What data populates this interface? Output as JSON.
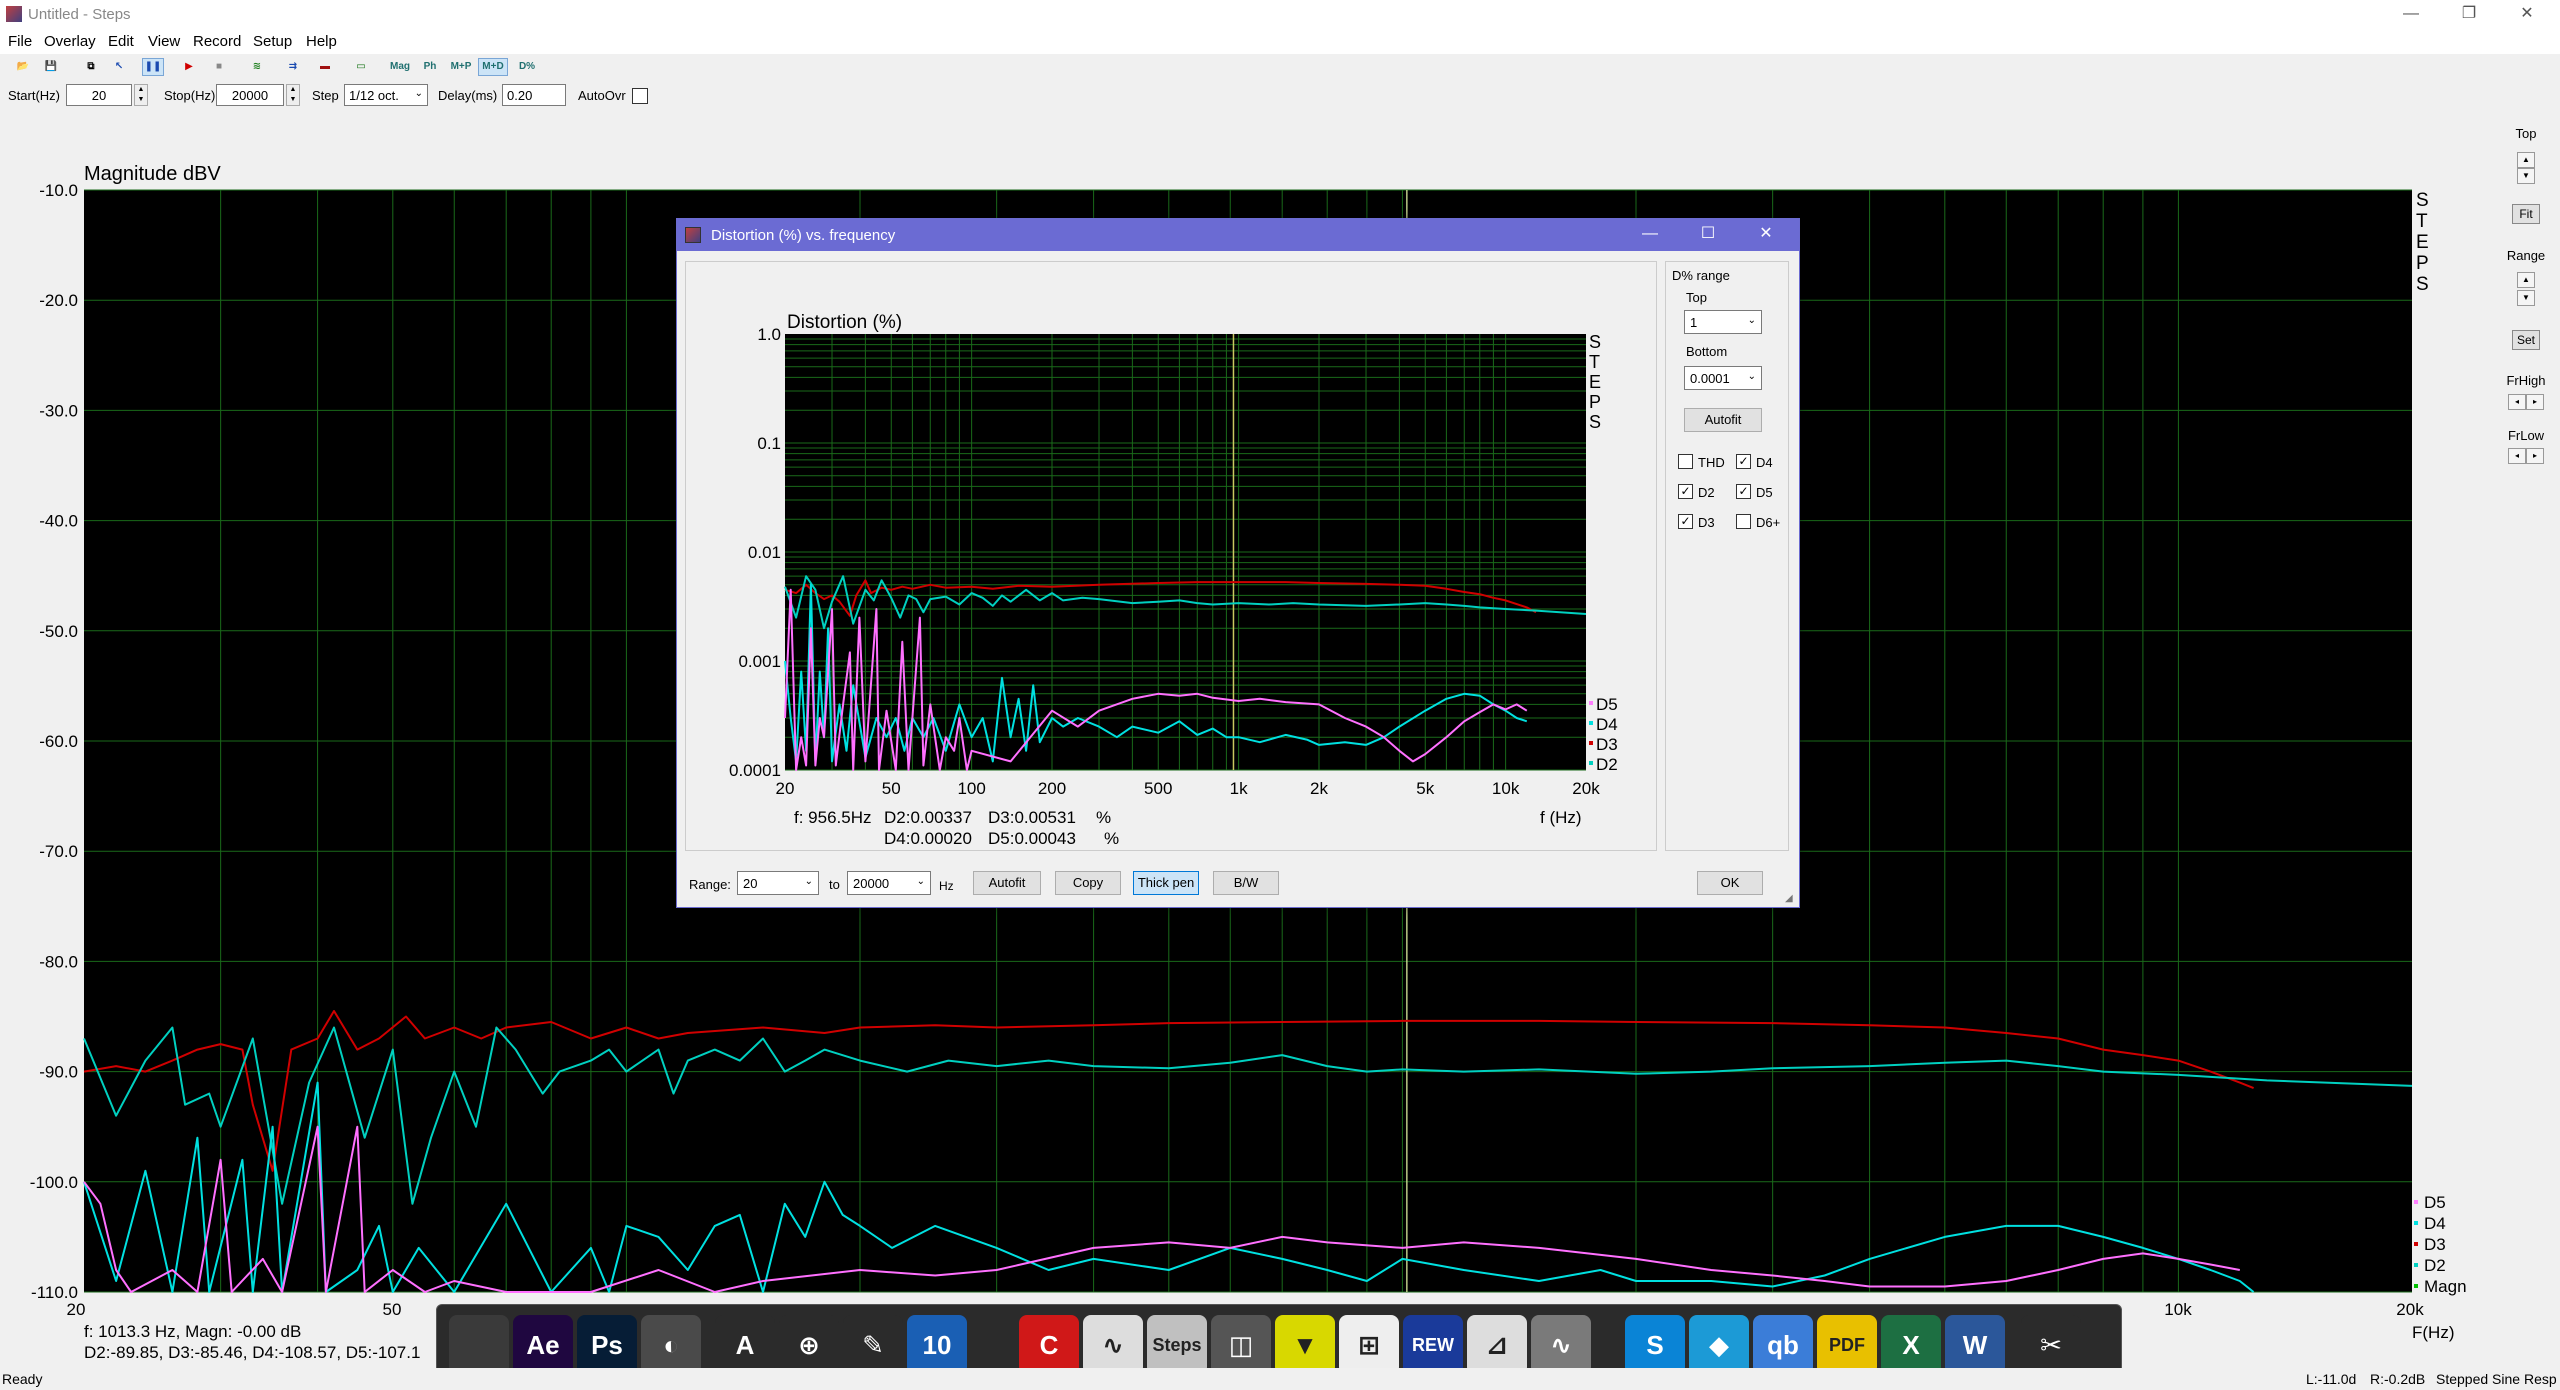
{
  "window": {
    "title": "Untitled - Steps",
    "minimize": "—",
    "restore": "❐",
    "close": "✕"
  },
  "menu": [
    "File",
    "Overlay",
    "Edit",
    "View",
    "Record",
    "Setup",
    "Help"
  ],
  "toolbar": {
    "buttons": [
      {
        "name": "open-icon",
        "label": "📂"
      },
      {
        "name": "save-icon",
        "label": "💾"
      },
      {
        "name": "copy-icon",
        "label": "⧉"
      },
      {
        "name": "cursor-icon",
        "label": "↖"
      },
      {
        "name": "pause-icon",
        "label": "❚❚"
      },
      {
        "name": "record-icon",
        "label": "▶"
      },
      {
        "name": "stop-icon",
        "label": "■"
      },
      {
        "name": "generator-icon",
        "label": "≋"
      },
      {
        "name": "overlay-icon",
        "label": "⇉"
      },
      {
        "name": "flag-icon",
        "label": "▬"
      },
      {
        "name": "display-icon",
        "label": "▭"
      }
    ],
    "text_buttons": [
      "Mag",
      "Ph",
      "M+P",
      "M+D",
      "D%"
    ]
  },
  "params": {
    "start_label": "Start(Hz)",
    "start_value": "20",
    "stop_label": "Stop(Hz)",
    "stop_value": "20000",
    "step_label": "Step",
    "step_value": "1/12 oct.",
    "delay_label": "Delay(ms)",
    "delay_value": "0.20",
    "autoovr_label": "AutoOvr"
  },
  "main_chart": {
    "ylabel": "Magnitude dBV",
    "xlabel": "F(Hz)",
    "yticks": [
      "-10.0",
      "-20.0",
      "-30.0",
      "-40.0",
      "-50.0",
      "-60.0",
      "-70.0",
      "-80.0",
      "-90.0",
      "-100.0",
      "-110.0"
    ],
    "xticks_visible": [
      "20",
      "50",
      "10k",
      "20k"
    ],
    "readout_line1": "f: 1013.3 Hz, Magn: -0.00 dB",
    "readout_line2": "D2:-89.85, D3:-85.46, D4:-108.57, D5:-107.1",
    "steps_vertical": "STEPS",
    "legend": [
      {
        "label": "D5",
        "color": "#ff80ff"
      },
      {
        "label": "D4",
        "color": "#00e0e0"
      },
      {
        "label": "D3",
        "color": "#d00000"
      },
      {
        "label": "D2",
        "color": "#00d0c0"
      },
      {
        "label": "Magn",
        "color": "#00c000"
      }
    ]
  },
  "right_panel": {
    "top_label": "Top",
    "fit_label": "Fit",
    "range_label": "Range",
    "set_label": "Set",
    "frhigh_label": "FrHigh",
    "frlow_label": "FrLow"
  },
  "dialog": {
    "title": "Distortion (%) vs. frequency",
    "minimize": "—",
    "maximize": "☐",
    "close": "✕",
    "chart_title": "Distortion (%)",
    "yticks": [
      "1.0",
      "0.1",
      "0.01",
      "0.001",
      "0.0001"
    ],
    "xticks": [
      "20",
      "50",
      "100",
      "200",
      "500",
      "1k",
      "2k",
      "5k",
      "10k",
      "20k"
    ],
    "xlabel": "f (Hz)",
    "steps_vertical": "STEPS",
    "readout": {
      "f": "f: 956.5Hz",
      "d2": "D2:0.00337",
      "d3": "D3:0.00531",
      "pct1": "%",
      "d4": "D4:0.00020",
      "d5": "D5:0.00043",
      "pct2": "%"
    },
    "legend": [
      {
        "label": "D5",
        "color": "#ff80ff"
      },
      {
        "label": "D4",
        "color": "#00e0e0"
      },
      {
        "label": "D3",
        "color": "#d00000"
      },
      {
        "label": "D2",
        "color": "#00d0c0"
      }
    ],
    "side": {
      "group_label": "D% range",
      "top_label": "Top",
      "top_value": "1",
      "bottom_label": "Bottom",
      "bottom_value": "0.0001",
      "autofit_label": "Autofit",
      "checks": [
        {
          "label": "THD",
          "checked": false
        },
        {
          "label": "D4",
          "checked": true
        },
        {
          "label": "D2",
          "checked": true
        },
        {
          "label": "D5",
          "checked": true
        },
        {
          "label": "D3",
          "checked": true
        },
        {
          "label": "D6+",
          "checked": false
        }
      ]
    },
    "bottom": {
      "range_label": "Range:",
      "range_from": "20",
      "to_label": "to",
      "range_to": "20000",
      "hz_label": "Hz",
      "autofit": "Autofit",
      "copy": "Copy",
      "thick_pen": "Thick pen",
      "bw": "B/W",
      "ok": "OK"
    }
  },
  "status": {
    "left": "Ready",
    "levels": "L:-11.0d",
    "right_level": "R:-0.2dB",
    "mode": "Stepped Sine Resp"
  },
  "dock": {
    "icons": [
      {
        "name": "edius-icon",
        "label": "",
        "color": "#3a3a3a"
      },
      {
        "name": "after-effects-icon",
        "label": "Ae",
        "color": "#1f0740"
      },
      {
        "name": "photoshop-icon",
        "label": "Ps",
        "color": "#061d36"
      },
      {
        "name": "davinci-icon",
        "label": "◐",
        "color": "#4a4a4a"
      },
      {
        "name": "wavelab-icon",
        "label": "A",
        "color": "#2b2b2b"
      },
      {
        "name": "green-tool-icon",
        "label": "⊕",
        "color": "#2b2b2b"
      },
      {
        "name": "pencil-icon",
        "label": "✎",
        "color": "#2b2b2b"
      },
      {
        "name": "ten-icon",
        "label": "10",
        "color": "#1a5fb4"
      },
      {
        "name": "red-c-icon",
        "label": "C",
        "color": "#d01818"
      },
      {
        "name": "analyzer-icon",
        "label": "∿",
        "color": "#ddd"
      },
      {
        "name": "steps-icon",
        "label": "Steps",
        "color": "#c0c0c0"
      },
      {
        "name": "speaker-icon",
        "label": "◫",
        "color": "#555"
      },
      {
        "name": "yellow-tool-icon",
        "label": "▼",
        "color": "#d8d800"
      },
      {
        "name": "graph-icon",
        "label": "⊞",
        "color": "#eee"
      },
      {
        "name": "rew-icon",
        "label": "REW",
        "color": "#1a3a9a"
      },
      {
        "name": "chart-icon",
        "label": "⊿",
        "color": "#ddd"
      },
      {
        "name": "wave-icon",
        "label": "∿",
        "color": "#7a7a7a"
      },
      {
        "name": "skype-icon",
        "label": "S",
        "color": "#0a84d6"
      },
      {
        "name": "kodi-icon",
        "label": "◆",
        "color": "#1c9ad6"
      },
      {
        "name": "qbittorrent-icon",
        "label": "qb",
        "color": "#3b7dd8"
      },
      {
        "name": "pdf-icon",
        "label": "PDF",
        "color": "#e8c000"
      },
      {
        "name": "excel-icon",
        "label": "X",
        "color": "#1d6f42"
      },
      {
        "name": "word-icon",
        "label": "W",
        "color": "#2b579a"
      },
      {
        "name": "tools-icon",
        "label": "✂",
        "color": "#2b2b2b"
      }
    ]
  }
}
